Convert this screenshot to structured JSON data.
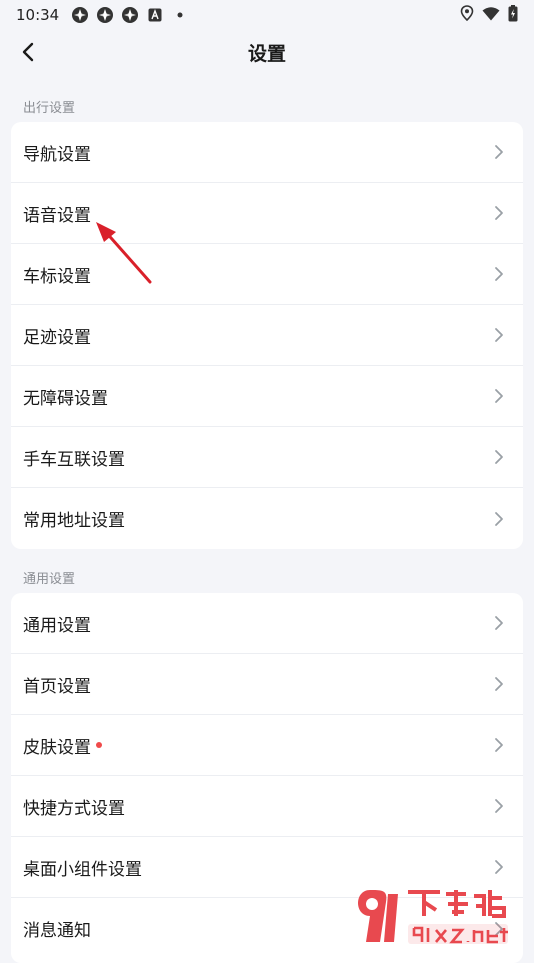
{
  "status_bar": {
    "time": "10:34",
    "left_icons": [
      "app-icon",
      "app-icon",
      "app-icon",
      "a-icon",
      "dot-icon"
    ],
    "right_icons": [
      "location-icon",
      "wifi-icon",
      "battery-icon"
    ]
  },
  "header": {
    "title": "设置"
  },
  "sections": [
    {
      "title": "出行设置",
      "items": [
        {
          "label": "导航设置"
        },
        {
          "label": "语音设置"
        },
        {
          "label": "车标设置"
        },
        {
          "label": "足迹设置"
        },
        {
          "label": "无障碍设置"
        },
        {
          "label": "手车互联设置"
        },
        {
          "label": "常用地址设置"
        }
      ]
    },
    {
      "title": "通用设置",
      "items": [
        {
          "label": "通用设置"
        },
        {
          "label": "首页设置"
        },
        {
          "label": "皮肤设置",
          "red_dot": true
        },
        {
          "label": "快捷方式设置"
        },
        {
          "label": "桌面小组件设置"
        },
        {
          "label": "消息通知"
        }
      ]
    }
  ],
  "watermark": {
    "site": "下载站",
    "domain": "91xz.net"
  },
  "colors": {
    "background": "#f4f5f9",
    "card": "#ffffff",
    "chevron": "#9aa0a6",
    "dot": "#f04a4a",
    "annotation": "#d9202a"
  }
}
